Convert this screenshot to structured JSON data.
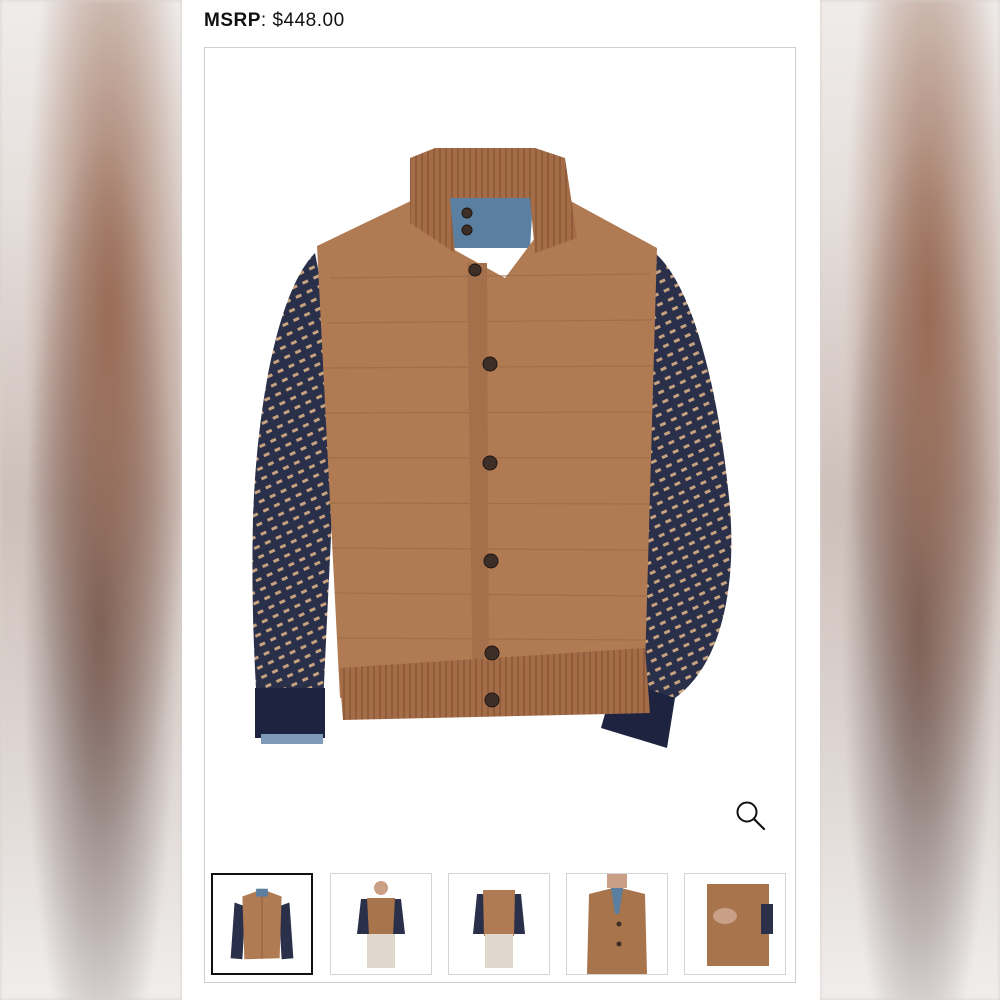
{
  "product": {
    "msrp_label": "MSRP",
    "msrp_separator": ": ",
    "msrp_value": "$448.00"
  },
  "gallery": {
    "zoom_icon": "magnifier-icon",
    "thumbnail_count": 5,
    "active_thumbnail": 1,
    "colors": {
      "body": "#b07a52",
      "sleeve": "#2a2f4a",
      "sleeve_dots": "#c7a27f",
      "rib": "#a46d48",
      "cuff": "#1e2440",
      "denim": "#5b7fa0"
    }
  }
}
